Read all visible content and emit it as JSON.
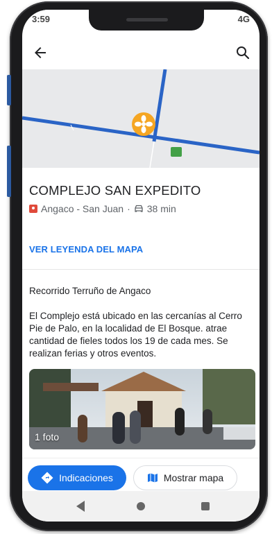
{
  "status_bar": {
    "time": "3:59",
    "signal": "4G"
  },
  "place": {
    "title": "COMPLEJO SAN EXPEDITO",
    "location": "Angaco - San Juan",
    "drive_time": "38 min"
  },
  "legend_link": "VER LEYENDA DEL MAPA",
  "tour": {
    "title": "Recorrido Terruño de Angaco",
    "description": "El Complejo está ubicado en las cercanías al Cerro Pie de Palo, en la localidad de El Bosque. atrae cantidad de fieles todos los  19 de cada mes. Se realizan ferias y otros eventos.",
    "photo_label": "1 foto"
  },
  "actions": {
    "directions_label": "Indicaciones",
    "show_map_label": "Mostrar mapa"
  },
  "colors": {
    "accent": "#1a73e8",
    "map_road": "#2a64c6",
    "map_marker": "#f5a623",
    "pin_red": "#e04a3b"
  },
  "icons": {
    "back": "arrow-left-icon",
    "search": "search-icon",
    "pin": "location-pin-icon",
    "car": "car-icon",
    "directions": "directions-icon",
    "map": "map-icon"
  }
}
